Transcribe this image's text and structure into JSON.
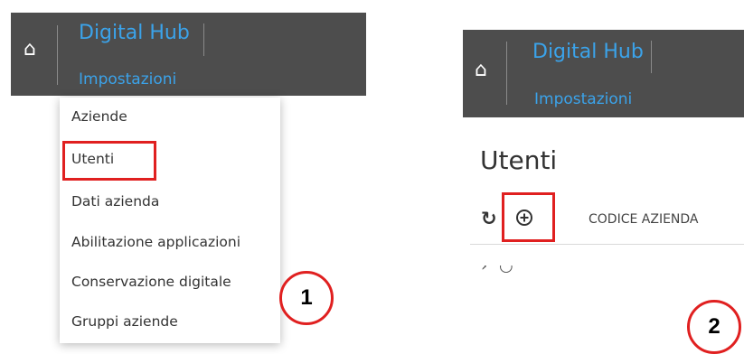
{
  "panel1": {
    "header": {
      "home_icon": "home-icon",
      "brand": "Digital Hub",
      "section": "Impostazioni"
    },
    "menu": {
      "items": [
        {
          "label": "Aziende"
        },
        {
          "label": "Utenti",
          "highlighted": true
        },
        {
          "label": "Dati azienda"
        },
        {
          "label": "Abilitazione applicazioni"
        },
        {
          "label": "Conservazione digitale"
        },
        {
          "label": "Gruppi aziende"
        }
      ]
    },
    "step_number": "1"
  },
  "panel2": {
    "header": {
      "home_icon": "home-icon",
      "brand": "Digital Hub",
      "section": "Impostazioni"
    },
    "page_title": "Utenti",
    "toolbar": {
      "refresh_icon": "refresh-icon",
      "add_icon": "plus-circle-icon"
    },
    "column_header": "CODICE AZIENDA",
    "step_number": "2"
  },
  "colors": {
    "header_bg": "#4d4d4d",
    "accent_blue": "#3ba3ea",
    "highlight_red": "#e02020"
  }
}
